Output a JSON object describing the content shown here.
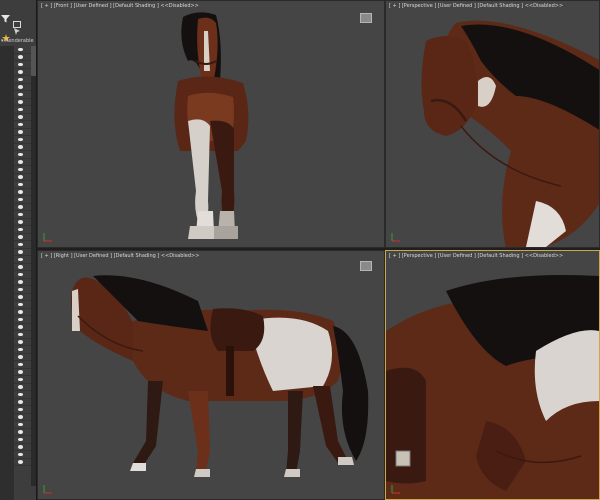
{
  "explorer": {
    "root_label": "Renderable",
    "row_count": 56
  },
  "viewports": [
    {
      "label": "[ + ] [Front ] [User Defined ] [Default Shading ] <<Disabled>>"
    },
    {
      "label": "[ + ] [Perspective ] [User Defined ] [Default Shading ] <<Disabled>>"
    },
    {
      "label": "[ + ] [Right ] [User Defined ] [Default Shading ] <<Disabled>>"
    },
    {
      "label": "[ + ] [Perspective ] [User Defined ] [Default Shading ] <<Disabled>>"
    }
  ],
  "colors": {
    "viewport_bg": "#454545",
    "active_border": "#c8a84a",
    "coat": "#6b2f1a",
    "mane": "#141010",
    "white_patch": "#d9d4cf"
  }
}
